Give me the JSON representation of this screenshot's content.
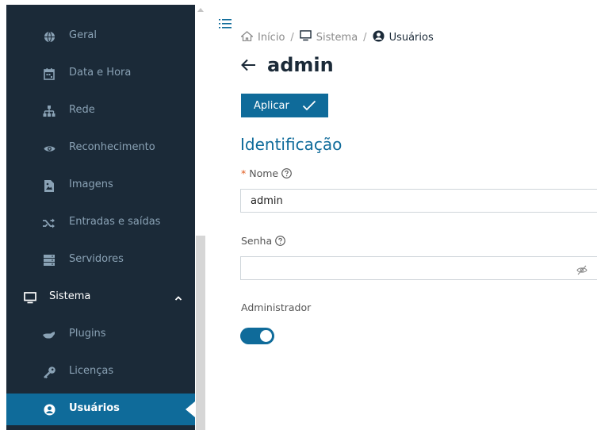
{
  "sidebar": {
    "items": [
      {
        "label": "Geral",
        "icon": "globe-icon"
      },
      {
        "label": "Data e Hora",
        "icon": "calendar-icon"
      },
      {
        "label": "Rede",
        "icon": "network-icon"
      },
      {
        "label": "Reconhecimento",
        "icon": "eye-icon"
      },
      {
        "label": "Imagens",
        "icon": "image-icon"
      },
      {
        "label": "Entradas e saídas",
        "icon": "shuffle-icon"
      },
      {
        "label": "Servidores",
        "icon": "server-icon"
      },
      {
        "label": "Sistema",
        "icon": "monitor-icon",
        "expanded": true
      },
      {
        "label": "Plugins",
        "icon": "plug-icon"
      },
      {
        "label": "Licenças",
        "icon": "key-icon"
      },
      {
        "label": "Usuários",
        "icon": "user-circle-icon",
        "active": true
      }
    ]
  },
  "breadcrumb": {
    "home": "Início",
    "system": "Sistema",
    "current": "Usuários"
  },
  "page": {
    "title": "admin"
  },
  "actions": {
    "apply_label": "Aplicar"
  },
  "form": {
    "section_title": "Identificação",
    "name_required_mark": "*",
    "name_label": "Nome",
    "name_value": "admin",
    "password_label": "Senha",
    "password_value": "",
    "admin_label": "Administrador",
    "admin_enabled": true
  },
  "colors": {
    "sidebar_bg": "#1b2a38",
    "accent": "#0f6b9a",
    "required": "#e05a1c"
  }
}
